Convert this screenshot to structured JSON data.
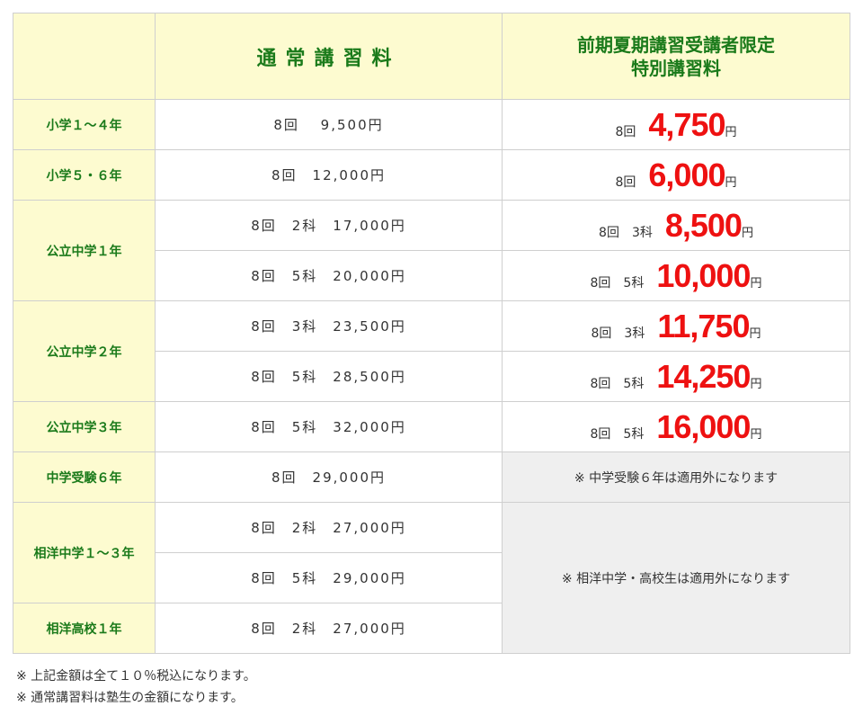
{
  "header": {
    "col_normal": "通常講習料",
    "col_special_line1": "前期夏期講習受講者限定",
    "col_special_line2": "特別講習料"
  },
  "rows": [
    {
      "grade": "小学１～４年",
      "normal": "8回　 9,500円",
      "sp_label": "8回",
      "sp_price": "4,750",
      "yen": "円"
    },
    {
      "grade": "小学５・６年",
      "normal": "8回　12,000円",
      "sp_label": "8回",
      "sp_price": "6,000",
      "yen": "円"
    },
    {
      "grade": "公立中学１年",
      "normal_a": "8回　2科　17,000円",
      "sp_label_a": "8回　3科",
      "sp_price_a": "8,500",
      "normal_b": "8回　5科　20,000円",
      "sp_label_b": "8回　5科",
      "sp_price_b": "10,000",
      "yen": "円"
    },
    {
      "grade": "公立中学２年",
      "normal_a": "8回　3科　23,500円",
      "sp_label_a": "8回　3科",
      "sp_price_a": "11,750",
      "normal_b": "8回　5科　28,500円",
      "sp_label_b": "8回　5科",
      "sp_price_b": "14,250",
      "yen": "円"
    },
    {
      "grade": "公立中学３年",
      "normal": "8回　5科　32,000円",
      "sp_label": "8回　5科",
      "sp_price": "16,000",
      "yen": "円"
    },
    {
      "grade": "中学受験６年",
      "normal": "8回　29,000円",
      "sp_note": "※ 中学受験６年は適用外になります"
    },
    {
      "grade": "相洋中学１～３年",
      "normal_a": "8回　2科　27,000円",
      "normal_b": "8回　5科　29,000円",
      "sp_note": "※ 相洋中学・高校生は適用外になります"
    },
    {
      "grade": "相洋高校１年",
      "normal": "8回　2科　27,000円"
    }
  ],
  "notes": [
    "※ 上記金額は全て１０％税込になります。",
    "※ 通常講習料は塾生の金額になります。"
  ]
}
